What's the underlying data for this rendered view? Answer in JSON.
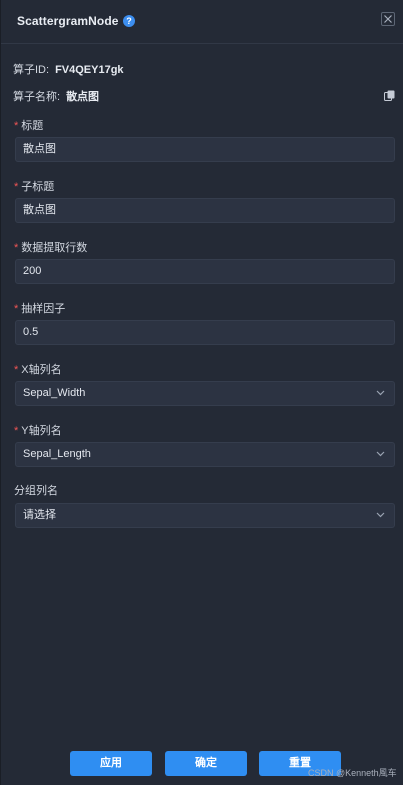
{
  "header": {
    "title": "ScattergramNode",
    "help_glyph": "?"
  },
  "info": {
    "id_label": "算子ID:",
    "id_value": "FV4QEY17gk",
    "name_label": "算子名称:",
    "name_value": "散点图"
  },
  "fields": [
    {
      "label": "标题",
      "required": true,
      "value": "散点图",
      "type": "text"
    },
    {
      "label": "子标题",
      "required": true,
      "value": "散点图",
      "type": "text"
    },
    {
      "label": "数据提取行数",
      "required": true,
      "value": "200",
      "type": "text"
    },
    {
      "label": "抽样因子",
      "required": true,
      "value": "0.5",
      "type": "text"
    },
    {
      "label": "X轴列名",
      "required": true,
      "value": "Sepal_Width",
      "type": "select"
    },
    {
      "label": "Y轴列名",
      "required": true,
      "value": "Sepal_Length",
      "type": "select"
    },
    {
      "label": "分组列名",
      "required": false,
      "value": "请选择",
      "type": "select"
    }
  ],
  "required_mark": "*",
  "buttons": {
    "apply": "应用",
    "confirm": "确定",
    "reset": "重置"
  },
  "watermark": "CSDN @Kenneth風车",
  "icons": {
    "help": "help-icon",
    "close": "close-icon",
    "copy": "copy-icon",
    "dropdown": "chevron-down-icon"
  },
  "colors": {
    "accent": "#2f8ef2",
    "required": "#f25656",
    "panel_bg": "#242a36",
    "input_bg": "#2c3342"
  }
}
